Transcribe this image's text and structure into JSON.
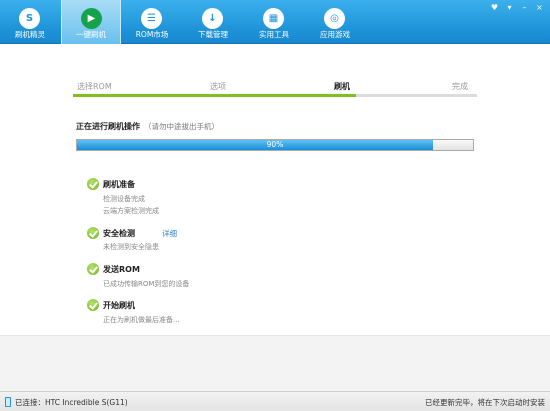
{
  "toolbar": {
    "items": [
      {
        "label": "刷机精灵",
        "icon": "logo-icon",
        "glyph": "S"
      },
      {
        "label": "一键刷机",
        "icon": "play-icon",
        "glyph": "▶",
        "active": true
      },
      {
        "label": "ROM市场",
        "icon": "rom-market-icon",
        "glyph": "☰"
      },
      {
        "label": "下载管理",
        "icon": "download-icon",
        "glyph": "↓"
      },
      {
        "label": "实用工具",
        "icon": "tools-icon",
        "glyph": "▦"
      },
      {
        "label": "应用游戏",
        "icon": "apps-games-icon",
        "glyph": "◎"
      }
    ],
    "window_buttons": [
      "♥",
      "▾",
      "–",
      "×"
    ]
  },
  "steps": {
    "items": [
      "选择ROM",
      "选项",
      "刷机",
      "完成"
    ],
    "current_index": 2,
    "progress_fraction": 0.7
  },
  "operation": {
    "title": "正在进行刷机操作",
    "hint": "（请勿中途拔出手机）",
    "progress_percent": 90,
    "progress_text": "90%"
  },
  "tasks": [
    {
      "title": "刷机准备",
      "details": [
        "检测设备完成",
        "云端方案检测完成"
      ]
    },
    {
      "title": "安全检测",
      "link": "详细",
      "details": [
        "未检测到安全隐患"
      ]
    },
    {
      "title": "发送ROM",
      "details": [
        "已成功传输ROM到您的设备"
      ]
    },
    {
      "title": "开始刷机",
      "details": [
        "正在为刷机做最后准备..."
      ]
    }
  ],
  "status": {
    "connection": "已连接：HTC Incredible S(G11)",
    "update": "已经更新完毕，将在下次启动时安装"
  },
  "colors": {
    "accent": "#1e93d8",
    "success": "#7ec11f",
    "link": "#2d82c8"
  }
}
